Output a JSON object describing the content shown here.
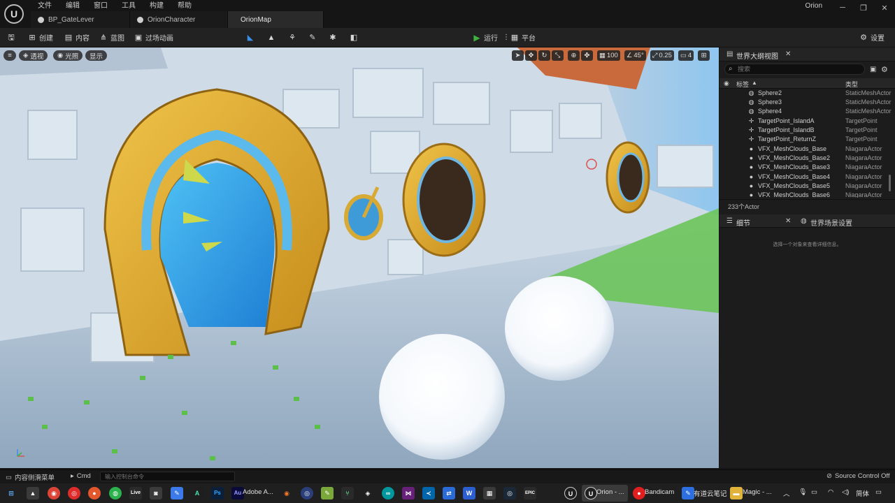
{
  "title_bar": {
    "logo_text": "U",
    "menus": [
      "文件",
      "编辑",
      "窗口",
      "工具",
      "构建",
      "帮助"
    ],
    "tabs": [
      {
        "label": "BP_GateLever"
      },
      {
        "label": "OrionCharacter"
      },
      {
        "label": "OrionMap"
      }
    ],
    "project_name": "Orion"
  },
  "toolbar": {
    "create_label": "创建",
    "content_label": "内容",
    "blueprint_label": "蓝图",
    "cinematics_label": "过场动画",
    "play_label": "运行",
    "platforms_label": "平台",
    "settings_label": "设置"
  },
  "viewport": {
    "perspective_label": "透视",
    "lit_label": "光照",
    "show_label": "显示",
    "grid_snap_value": "100",
    "rotation_snap_value": "45°",
    "scale_snap_value": "0.25",
    "camera_speed_value": "4"
  },
  "outliner": {
    "title": "世界大纲视图",
    "search_placeholder": "搜索",
    "col_label": "标签",
    "col_type": "类型",
    "rows": [
      {
        "name": "Sphere2",
        "type": "StaticMeshActor",
        "icon": "sphere-icon"
      },
      {
        "name": "Sphere3",
        "type": "StaticMeshActor",
        "icon": "sphere-icon"
      },
      {
        "name": "Sphere4",
        "type": "StaticMeshActor",
        "icon": "sphere-icon"
      },
      {
        "name": "TargetPoint_IslandA",
        "type": "TargetPoint",
        "icon": "crosshair-icon"
      },
      {
        "name": "TargetPoint_IslandB",
        "type": "TargetPoint",
        "icon": "crosshair-icon"
      },
      {
        "name": "TargetPoint_ReturnZ",
        "type": "TargetPoint",
        "icon": "crosshair-icon"
      },
      {
        "name": "VFX_MeshClouds_Base",
        "type": "NiagaraActor",
        "icon": "particle-icon"
      },
      {
        "name": "VFX_MeshClouds_Base2",
        "type": "NiagaraActor",
        "icon": "particle-icon"
      },
      {
        "name": "VFX_MeshClouds_Base3",
        "type": "NiagaraActor",
        "icon": "particle-icon"
      },
      {
        "name": "VFX_MeshClouds_Base4",
        "type": "NiagaraActor",
        "icon": "particle-icon"
      },
      {
        "name": "VFX_MeshClouds_Base5",
        "type": "NiagaraActor",
        "icon": "particle-icon"
      },
      {
        "name": "VFX_MeshClouds_Base6",
        "type": "NiagaraActor",
        "icon": "particle-icon"
      }
    ],
    "actor_count": "233个Actor"
  },
  "details": {
    "tab_label": "细节",
    "world_settings_label": "世界场景设置",
    "empty_hint": "选择一个对象来查看详细信息。"
  },
  "bottom_bar": {
    "content_drawer_label": "内容侧滑菜单",
    "cmd_label": "Cmd",
    "cmd_placeholder": "输入控制台命令",
    "source_control_label": "Source Control Off"
  },
  "taskbar": {
    "adobe_label": "Adobe A...",
    "orion_label": "Orion - ...",
    "bandicam_label": "Bandicam",
    "youdao_label": "有道云笔记",
    "magic_label": "Magic - ...",
    "ime_label": "简体"
  },
  "colors": {
    "accent_play": "#3db33d",
    "portal_gold": "#d9a52a",
    "portal_blue": "#3aa7e8"
  }
}
